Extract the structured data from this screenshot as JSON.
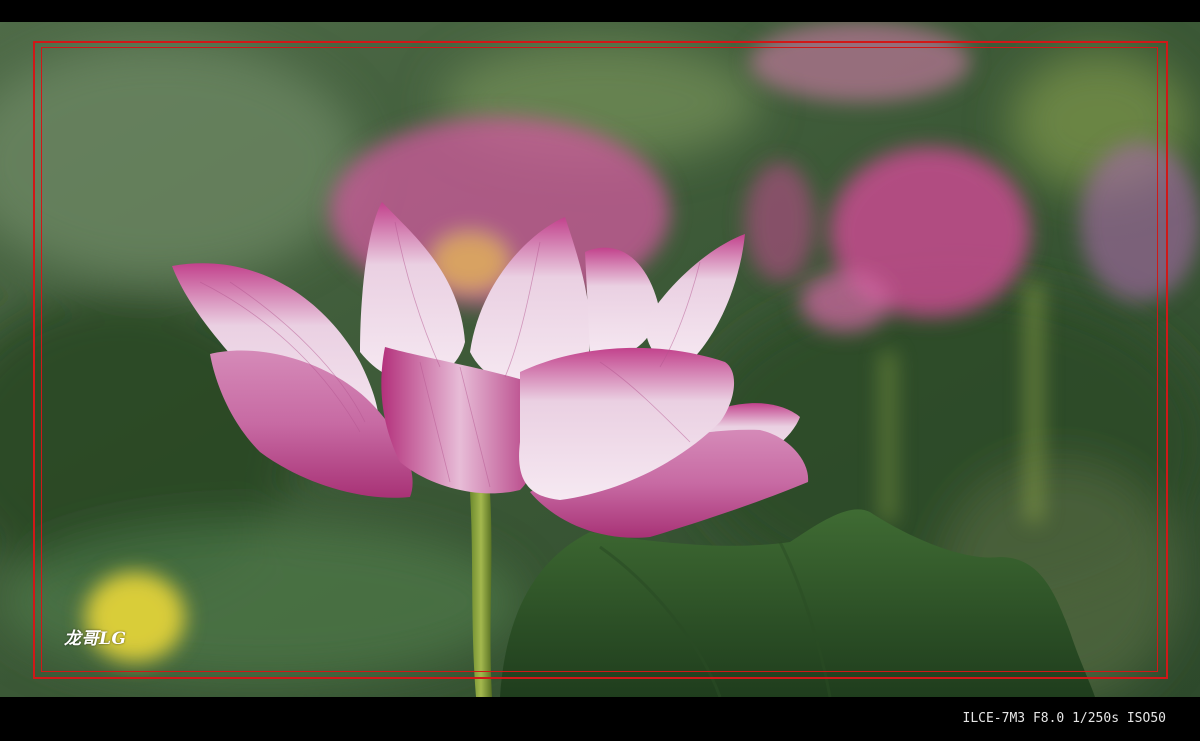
{
  "photo": {
    "subject": "lotus-flower",
    "colors": {
      "background": "#000000",
      "frame_border": "#d01818",
      "petal_pink": "#c43c8a",
      "petal_light": "#f4e3ef",
      "leaf_green": "#2f5a2a",
      "bokeh_yellow": "#e2d23a"
    }
  },
  "watermark": {
    "signature": "龙哥LG"
  },
  "caption": {
    "exif": "ILCE-7M3 F8.0 1/250s ISO50"
  }
}
